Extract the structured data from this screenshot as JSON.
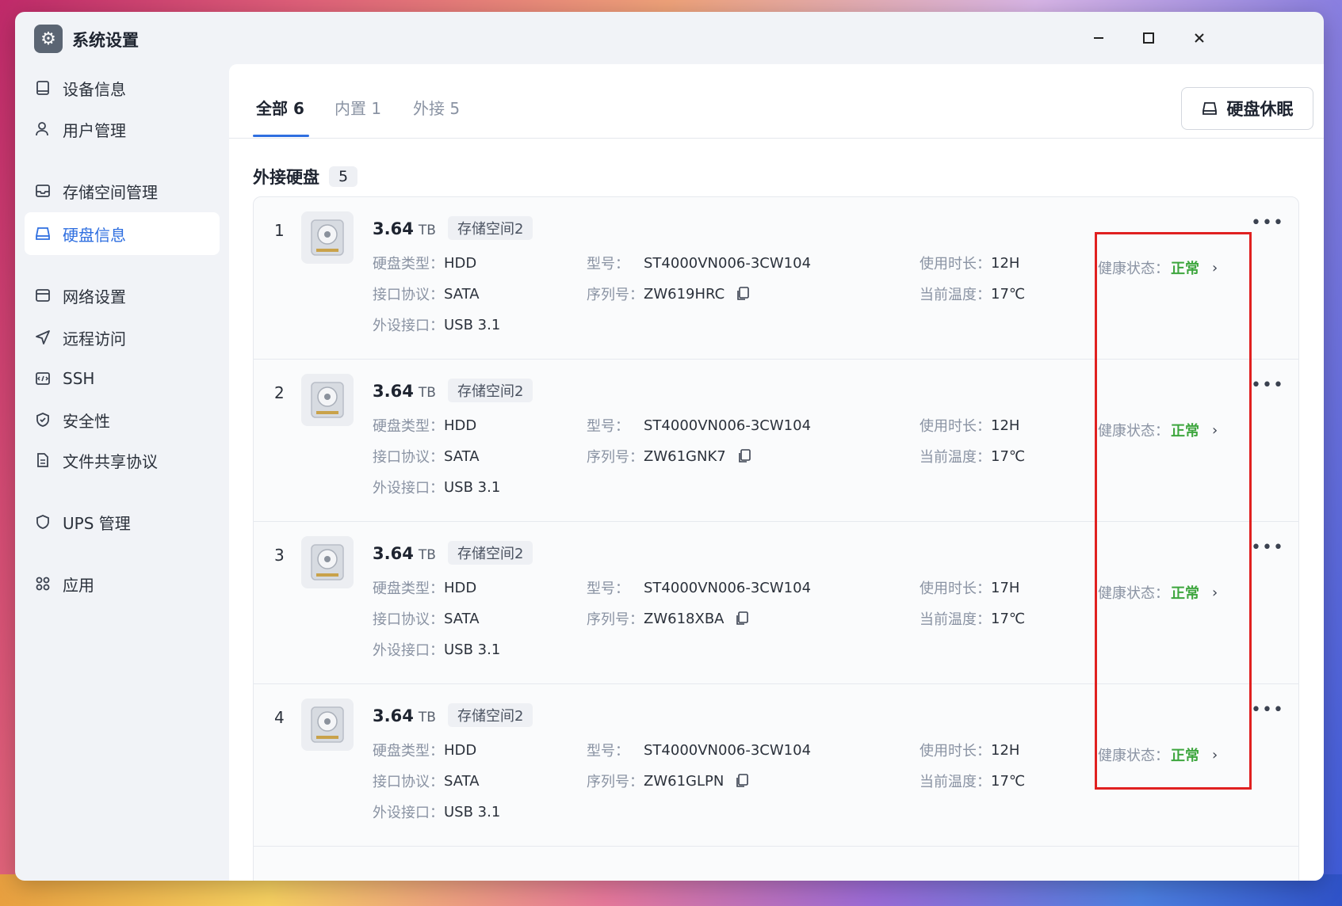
{
  "app": {
    "title": "系统设置",
    "icon": "gear-icon"
  },
  "window_controls": {
    "minimize": "—",
    "maximize": "☐",
    "close": "✕"
  },
  "sidebar": {
    "items": [
      {
        "label": "设备信息",
        "icon": "device-icon"
      },
      {
        "label": "用户管理",
        "icon": "user-icon"
      },
      {
        "label": "存储空间管理",
        "icon": "storage-icon"
      },
      {
        "label": "硬盘信息",
        "icon": "disk-icon",
        "active": true
      },
      {
        "label": "网络设置",
        "icon": "network-icon"
      },
      {
        "label": "远程访问",
        "icon": "remote-icon"
      },
      {
        "label": "SSH",
        "icon": "ssh-icon"
      },
      {
        "label": "安全性",
        "icon": "shield-icon"
      },
      {
        "label": "文件共享协议",
        "icon": "file-share-icon"
      },
      {
        "label": "UPS 管理",
        "icon": "ups-icon"
      },
      {
        "label": "应用",
        "icon": "apps-icon"
      }
    ]
  },
  "tabs": [
    {
      "label": "全部 6",
      "active": true
    },
    {
      "label": "内置 1"
    },
    {
      "label": "外接 5"
    }
  ],
  "sleep_button": {
    "label": "硬盘休眠"
  },
  "section": {
    "title": "外接硬盘",
    "count": "5"
  },
  "labels": {
    "disk_type": "硬盘类型：",
    "interface": "接口协议：",
    "external_port": "外设接口：",
    "model": "型号：",
    "serial": "序列号：",
    "usage": "使用时长：",
    "temperature": "当前温度：",
    "health": "健康状态：",
    "more": "•••"
  },
  "disks": [
    {
      "index": "1",
      "capacity": "3.64",
      "unit": "TB",
      "pool": "存储空间2",
      "type": "HDD",
      "protocol": "SATA",
      "port": "USB 3.1",
      "model": "ST4000VN006-3CW104",
      "serial": "ZW619HRC",
      "usage": "12H",
      "temp": "17℃",
      "health": "正常"
    },
    {
      "index": "2",
      "capacity": "3.64",
      "unit": "TB",
      "pool": "存储空间2",
      "type": "HDD",
      "protocol": "SATA",
      "port": "USB 3.1",
      "model": "ST4000VN006-3CW104",
      "serial": "ZW61GNK7",
      "usage": "12H",
      "temp": "17℃",
      "health": "正常"
    },
    {
      "index": "3",
      "capacity": "3.64",
      "unit": "TB",
      "pool": "存储空间2",
      "type": "HDD",
      "protocol": "SATA",
      "port": "USB 3.1",
      "model": "ST4000VN006-3CW104",
      "serial": "ZW618XBA",
      "usage": "17H",
      "temp": "17℃",
      "health": "正常"
    },
    {
      "index": "4",
      "capacity": "3.64",
      "unit": "TB",
      "pool": "存储空间2",
      "type": "HDD",
      "protocol": "SATA",
      "port": "USB 3.1",
      "model": "ST4000VN006-3CW104",
      "serial": "ZW61GLPN",
      "usage": "12H",
      "temp": "17℃",
      "health": "正常"
    }
  ],
  "colors": {
    "accent": "#2f6fe0",
    "healthy": "#3ea63e",
    "highlight": "#e02020"
  }
}
